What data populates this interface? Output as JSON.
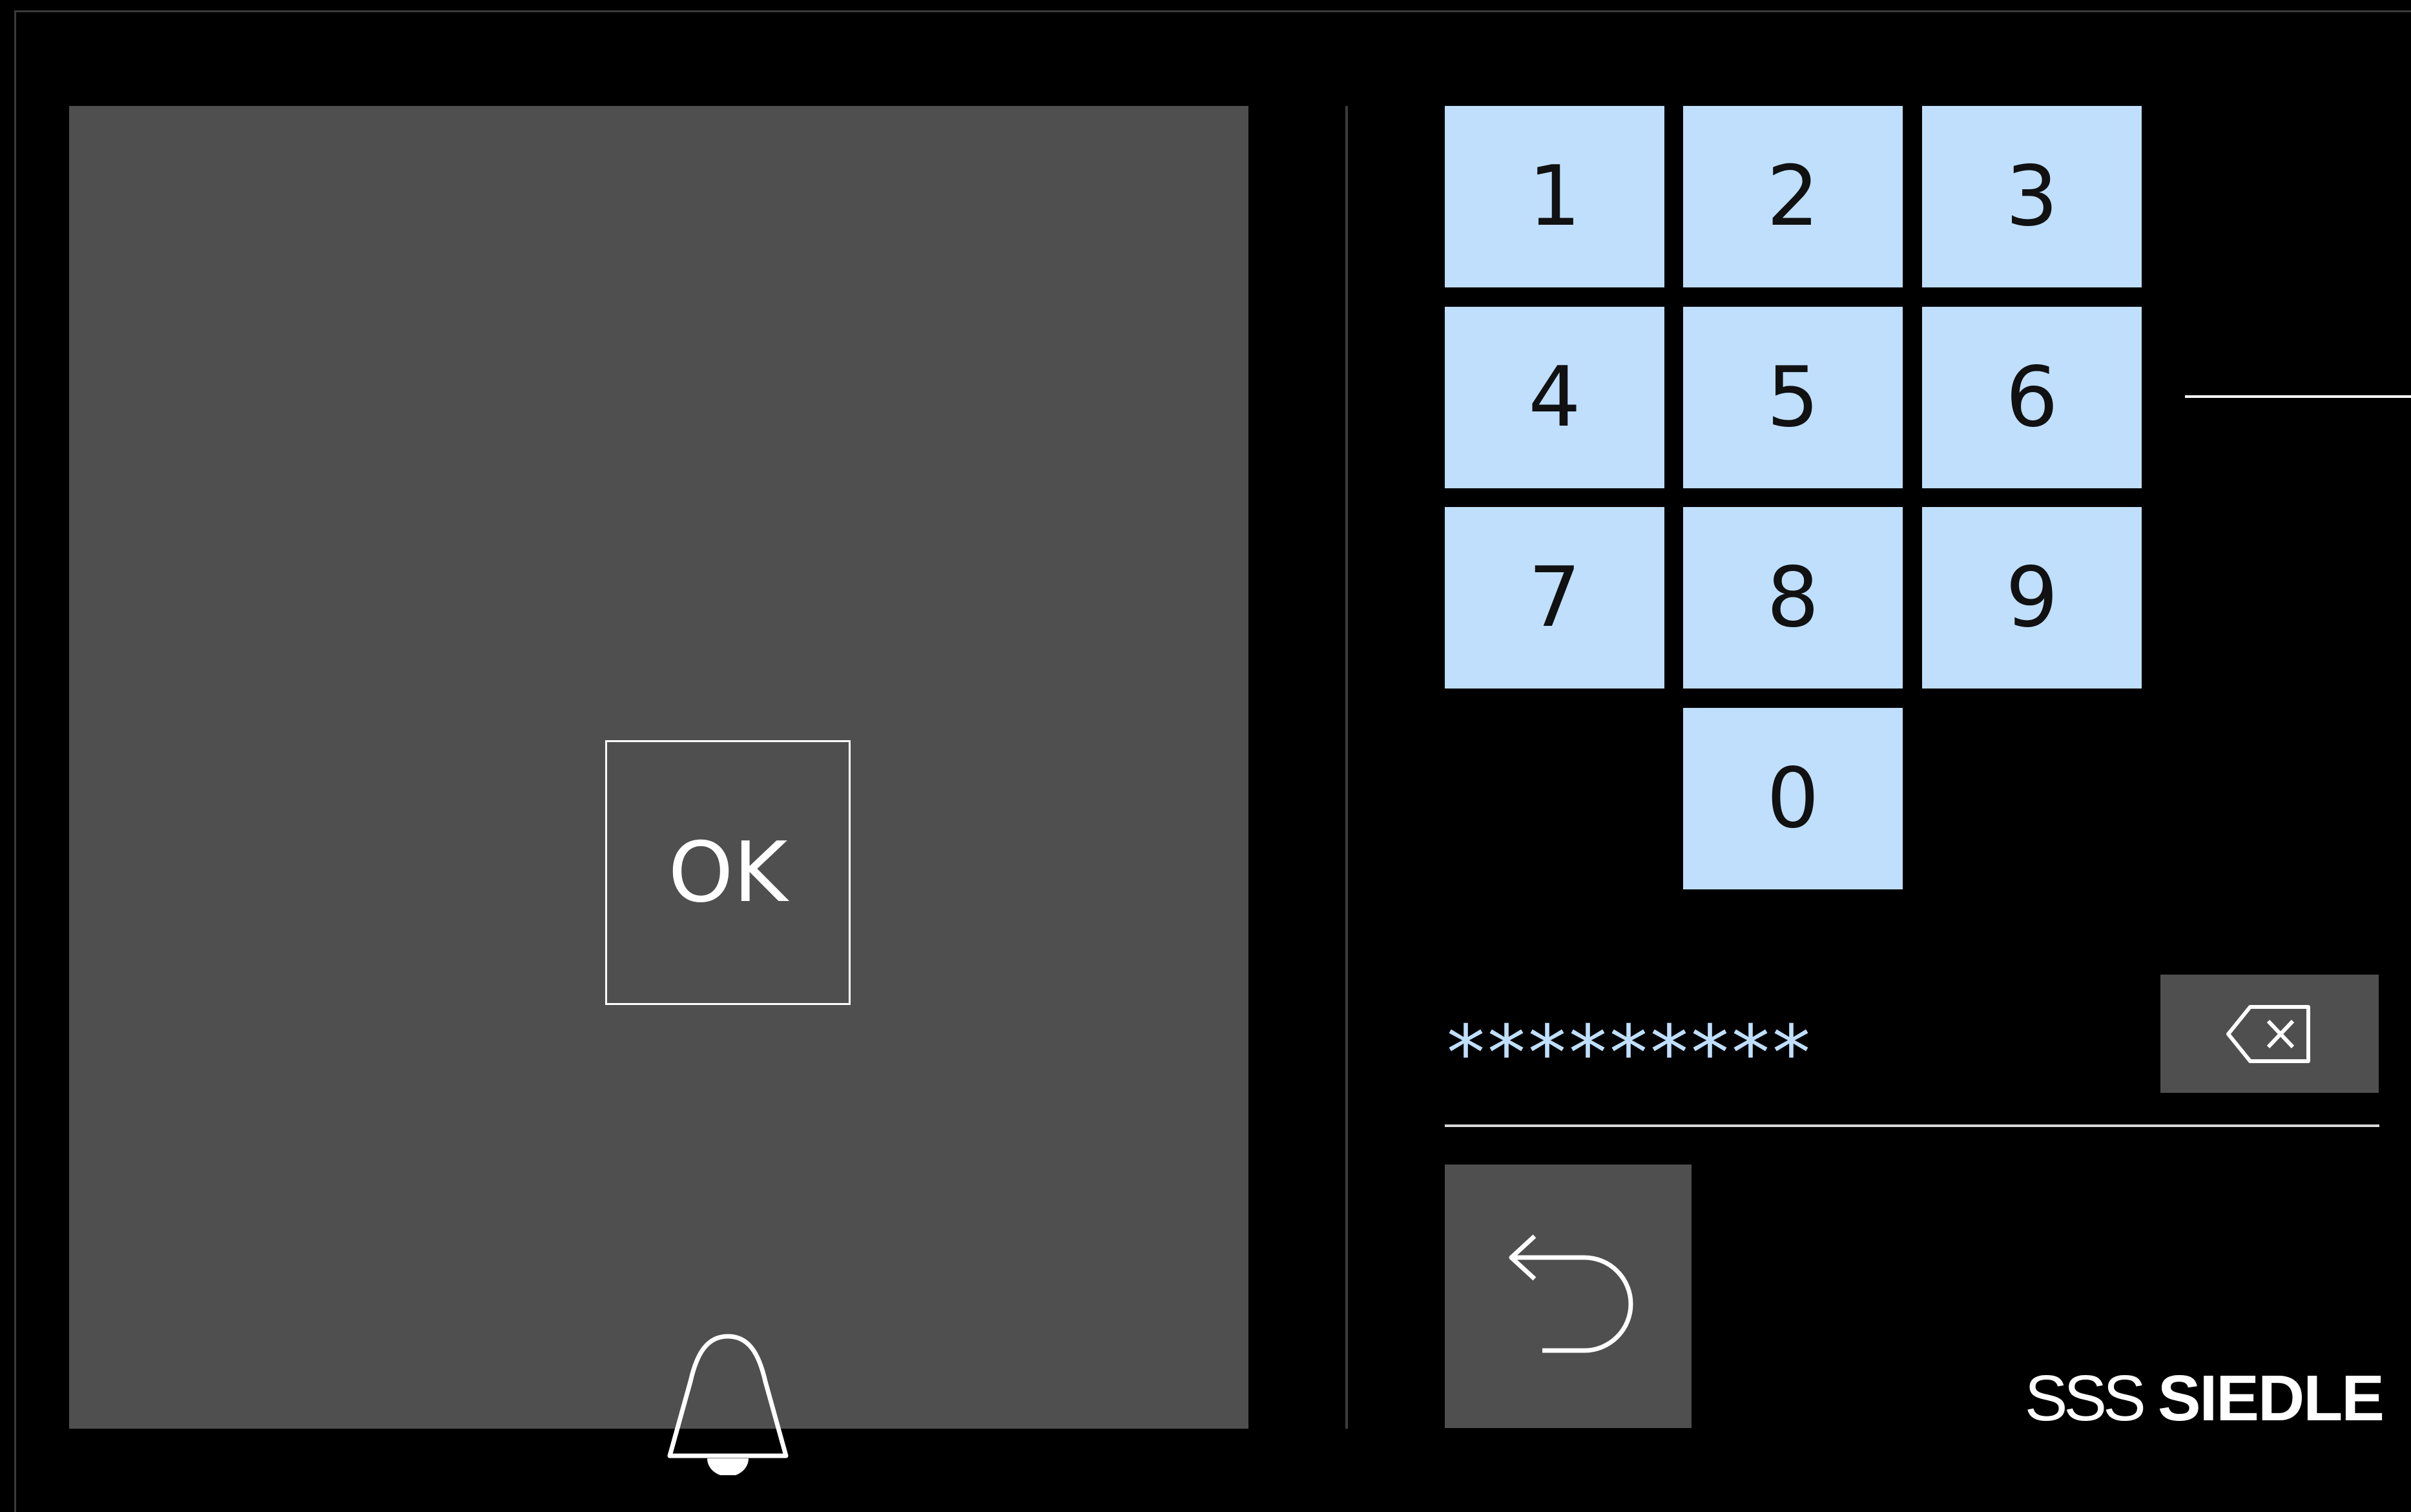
{
  "left_panel": {
    "ok_label": "OK",
    "bell_icon": "bell-icon"
  },
  "keypad": {
    "keys": [
      "1",
      "2",
      "3",
      "4",
      "5",
      "6",
      "7",
      "8",
      "9",
      "0"
    ]
  },
  "pin_entry": {
    "masked_value": "*********"
  },
  "controls": {
    "backspace_icon": "backspace-icon",
    "back_icon": "back-arrow-icon"
  },
  "branding": {
    "logo_mark": "SSS",
    "logo_word": "SIEDLE"
  },
  "colors": {
    "background": "#000000",
    "panel": "#4f4f4f",
    "key": "#bfdffd",
    "text_light": "#ffffff",
    "pin_text": "#bfdffd"
  }
}
